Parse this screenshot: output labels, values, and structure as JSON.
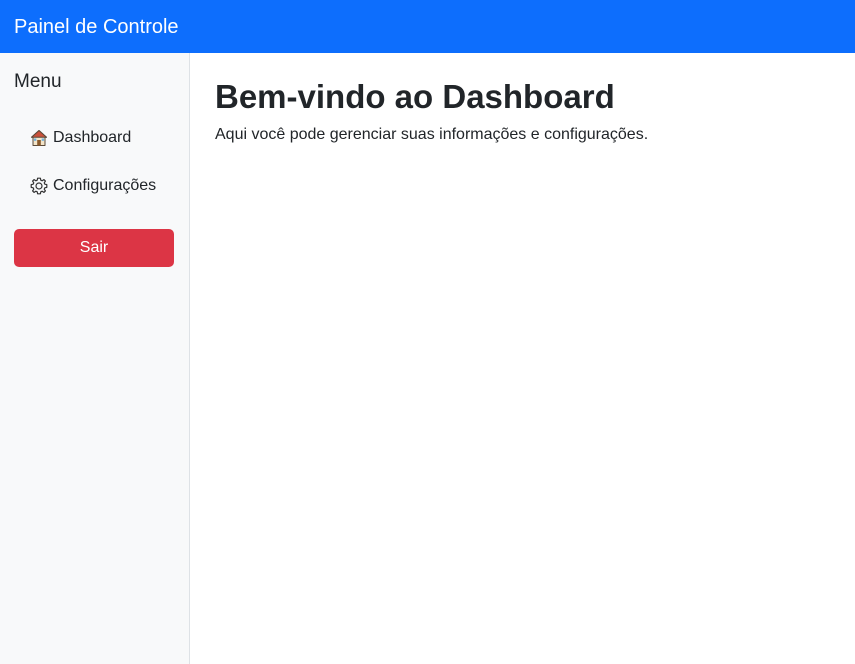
{
  "navbar": {
    "brand": "Painel de Controle",
    "color": "#0d6efd"
  },
  "sidebar": {
    "title": "Menu",
    "items": [
      {
        "label": "Dashboard",
        "icon": "house-icon"
      },
      {
        "label": "Configurações",
        "icon": "gear-icon"
      }
    ],
    "logout_label": "Sair",
    "logout_color": "#dc3545"
  },
  "main": {
    "title": "Bem-vindo ao Dashboard",
    "subtitle": "Aqui você pode gerenciar suas informações e configurações."
  }
}
